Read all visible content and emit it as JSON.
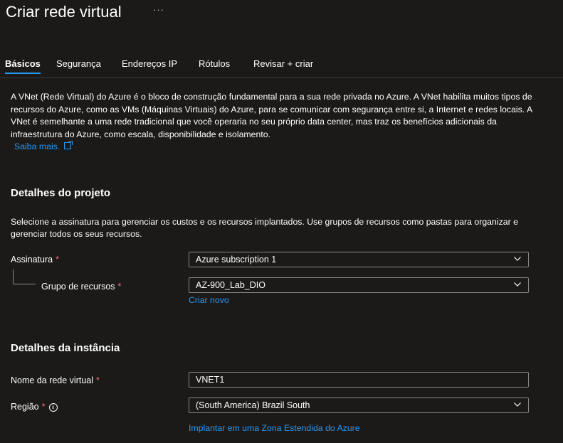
{
  "page": {
    "title": "Criar rede virtual",
    "more": "···"
  },
  "tabs": [
    {
      "label": "Básicos",
      "active": true
    },
    {
      "label": "Segurança"
    },
    {
      "label": "Endereços IP"
    },
    {
      "label": "Rótulos"
    },
    {
      "label": "Revisar + criar"
    }
  ],
  "intro": {
    "text": "A VNet (Rede Virtual) do Azure é o bloco de construção fundamental para a sua rede privada no Azure. A VNet habilita muitos tipos de recursos do Azure, como as VMs (Máquinas Virtuais) do Azure, para se comunicar com segurança entre si, a Internet e redes locais. A VNet é semelhante a uma rede tradicional que você operaria no seu próprio data center, mas traz os benefícios adicionais da infraestrutura do Azure, como escala, disponibilidade e isolamento.",
    "learn_more": "Saiba mais."
  },
  "project": {
    "heading": "Detalhes do projeto",
    "description": "Selecione a assinatura para gerenciar os custos e os recursos implantados. Use grupos de recursos como pastas para organizar e gerenciar todos os seus recursos.",
    "subscription_label": "Assinatura",
    "subscription_value": "Azure subscription 1",
    "resource_group_label": "Grupo de recursos",
    "resource_group_value": "AZ-900_Lab_DIO",
    "create_new": "Criar novo",
    "required_mark": "*"
  },
  "instance": {
    "heading": "Detalhes da instância",
    "name_label": "Nome da rede virtual",
    "name_value": "VNET1",
    "region_label": "Região",
    "region_value": "(South America) Brazil South",
    "info_icon": "i",
    "edge_zone_link": "Implantar em uma Zona Estendida do Azure",
    "required_mark": "*"
  },
  "colors": {
    "background": "#1b1a19",
    "accent": "#2899f5",
    "required": "#f1707b",
    "border": "#8a8886"
  }
}
